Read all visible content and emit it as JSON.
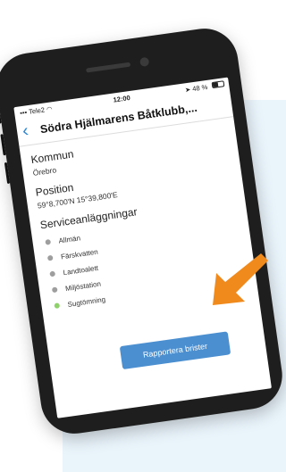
{
  "status_bar": {
    "carrier": "Tele2",
    "time": "12:00",
    "battery": "48 %",
    "battery_level": 0.48
  },
  "nav": {
    "back_icon": "chevron-left-icon",
    "title": "Södra Hjälmarens Båtklubb,..."
  },
  "kommun": {
    "label": "Kommun",
    "value": "Örebro"
  },
  "position": {
    "label": "Position",
    "value": "59°8,700'N 15°39,800'E"
  },
  "services": {
    "label": "Serviceanläggningar",
    "items": [
      {
        "label": "Allmän",
        "color": "#9e9e9e"
      },
      {
        "label": "Färskvatten",
        "color": "#9e9e9e"
      },
      {
        "label": "Landtoalett",
        "color": "#9e9e9e"
      },
      {
        "label": "Miljöstation",
        "color": "#9e9e9e"
      },
      {
        "label": "Sugtömning",
        "color": "#8fd16a"
      }
    ]
  },
  "report_button": {
    "label": "Rapportera brister",
    "color": "#4b8fd1"
  },
  "colors": {
    "accent": "#2a86d6",
    "arrow": "#f08a1c",
    "background_panel": "#e9f4fb",
    "phone_body": "#1e1e1e"
  }
}
